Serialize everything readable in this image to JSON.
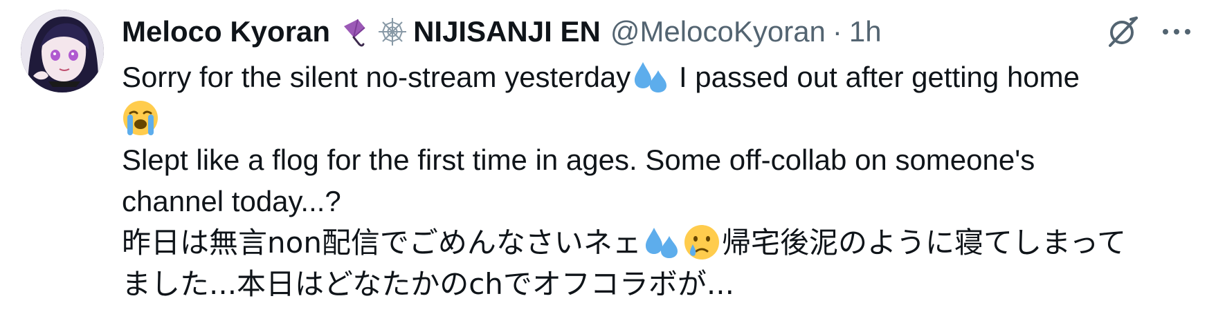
{
  "tweet": {
    "author": {
      "display_name": "Meloco Kyoran",
      "name_emojis": [
        "umbrella-emoji",
        "spider-web-emoji"
      ],
      "affiliation": "NIJISANJI EN",
      "handle": "@MelocoKyoran",
      "separator": "·",
      "time": "1h",
      "avatar_icon": "avatar-image"
    },
    "actions": {
      "grok_icon": "grok-icon",
      "more_icon": "more-icon"
    },
    "text": {
      "line1_part1": "Sorry for the silent no-stream yesterday",
      "line1_part2": " I passed out after getting home",
      "line3": "Slept like a flog for the first time in ages. Some off-collab on someone's",
      "line4": "channel today...?",
      "line5_part1": "昨日は無言non配信でごめんなさいネェ",
      "line5_part2": "帰宅後泥のように寝てしまって",
      "line6": "ました...本日はどなたかのchでオフコラボが..."
    },
    "emojis": {
      "sweat_droplets": "sweat-droplets-emoji",
      "loudly_crying": "loudly-crying-emoji",
      "crying_face": "crying-face-emoji"
    },
    "colors": {
      "text": "#0f1419",
      "secondary": "#536471",
      "droplet_blue": "#5dadec",
      "emoji_yellow": "#ffcc4d"
    }
  }
}
